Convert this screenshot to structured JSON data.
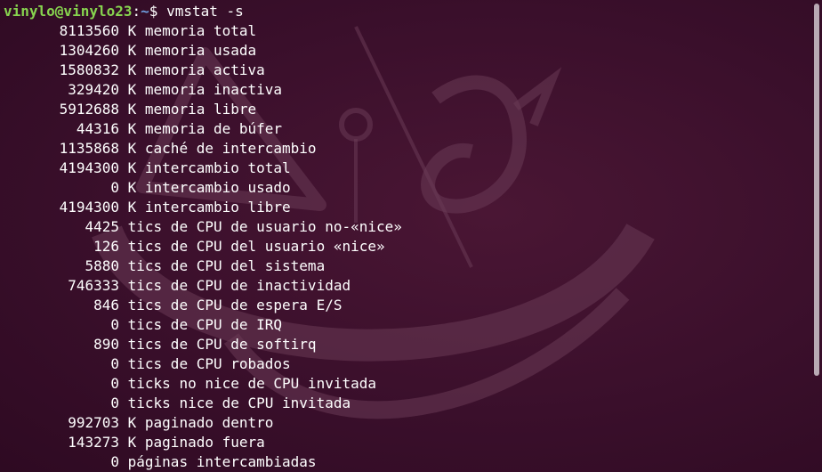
{
  "prompt": {
    "user_host": "vinylo@vinylo23",
    "separator": ":",
    "path": "~",
    "symbol": "$",
    "command": "vmstat -s"
  },
  "rows": [
    {
      "value": "8113560",
      "label": "K memoria total"
    },
    {
      "value": "1304260",
      "label": "K memoria usada"
    },
    {
      "value": "1580832",
      "label": "K memoria activa"
    },
    {
      "value": "329420",
      "label": "K memoria inactiva"
    },
    {
      "value": "5912688",
      "label": "K memoria libre"
    },
    {
      "value": "44316",
      "label": "K memoria de búfer"
    },
    {
      "value": "1135868",
      "label": "K caché de intercambio"
    },
    {
      "value": "4194300",
      "label": "K intercambio total"
    },
    {
      "value": "0",
      "label": "K intercambio usado"
    },
    {
      "value": "4194300",
      "label": "K intercambio libre"
    },
    {
      "value": "4425",
      "label": "tics de CPU de usuario no-«nice»"
    },
    {
      "value": "126",
      "label": "tics de CPU del usuario «nice»"
    },
    {
      "value": "5880",
      "label": "tics de CPU del sistema"
    },
    {
      "value": "746333",
      "label": "tics de CPU de inactividad"
    },
    {
      "value": "846",
      "label": "tics de CPU de espera E/S"
    },
    {
      "value": "0",
      "label": "tics de CPU de IRQ"
    },
    {
      "value": "890",
      "label": "tics de CPU de softirq"
    },
    {
      "value": "0",
      "label": "tics de CPU robados"
    },
    {
      "value": "0",
      "label": "ticks no nice de CPU invitada"
    },
    {
      "value": "0",
      "label": "ticks nice de CPU invitada"
    },
    {
      "value": "992703",
      "label": "K paginado dentro"
    },
    {
      "value": "143273",
      "label": "K paginado fuera"
    },
    {
      "value": "0",
      "label": "páginas intercambiadas"
    }
  ],
  "colors": {
    "background": "#300a24",
    "prompt_user": "#87d44f",
    "prompt_path": "#6f9fe0",
    "text": "#ffffff"
  }
}
